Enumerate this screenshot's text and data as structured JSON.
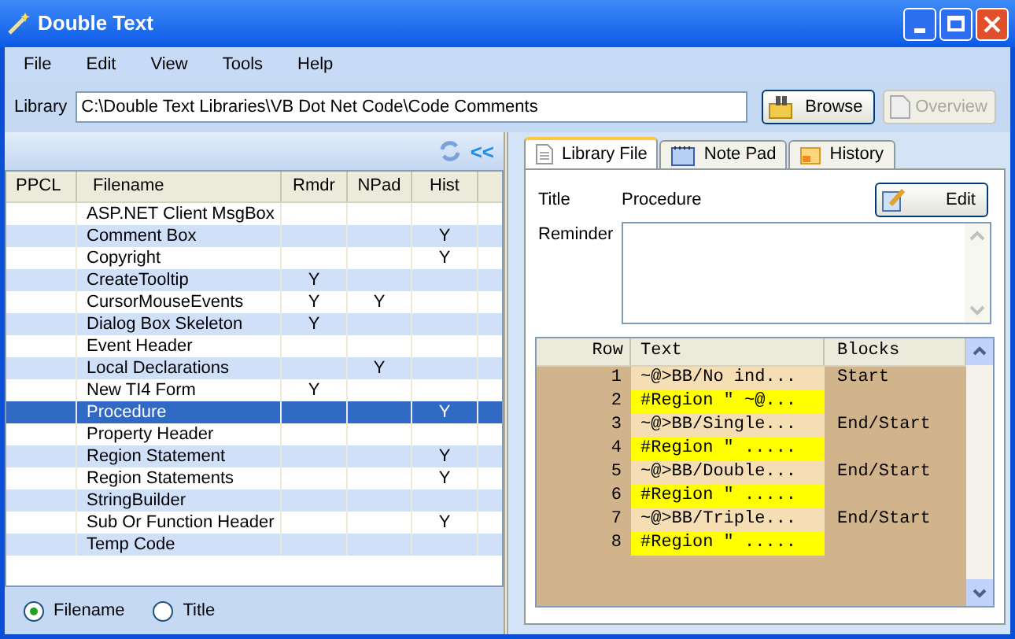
{
  "window": {
    "title": "Double Text"
  },
  "menu": [
    "File",
    "Edit",
    "View",
    "Tools",
    "Help"
  ],
  "library": {
    "label": "Library",
    "value": "C:\\Double Text Libraries\\VB Dot Net Code\\Code Comments",
    "browse": "Browse",
    "overview": {
      "label": "Overview",
      "disabled": true
    }
  },
  "collapse_glyph": "<<",
  "file_table": {
    "columns": [
      "PPCL",
      "Filename",
      "Rmdr",
      "NPad",
      "Hist"
    ],
    "rows": [
      {
        "filename": "ASP.NET Client MsgBox",
        "rmdr": "",
        "npad": "",
        "hist": "",
        "selected": false
      },
      {
        "filename": "Comment Box",
        "rmdr": "",
        "npad": "",
        "hist": "Y",
        "selected": false
      },
      {
        "filename": "Copyright",
        "rmdr": "",
        "npad": "",
        "hist": "Y",
        "selected": false
      },
      {
        "filename": "CreateTooltip",
        "rmdr": "Y",
        "npad": "",
        "hist": "",
        "selected": false
      },
      {
        "filename": "CursorMouseEvents",
        "rmdr": "Y",
        "npad": "Y",
        "hist": "",
        "selected": false
      },
      {
        "filename": "Dialog Box Skeleton",
        "rmdr": "Y",
        "npad": "",
        "hist": "",
        "selected": false
      },
      {
        "filename": "Event Header",
        "rmdr": "",
        "npad": "",
        "hist": "",
        "selected": false
      },
      {
        "filename": "Local Declarations",
        "rmdr": "",
        "npad": "Y",
        "hist": "",
        "selected": false
      },
      {
        "filename": "New TI4 Form",
        "rmdr": "Y",
        "npad": "",
        "hist": "",
        "selected": false
      },
      {
        "filename": "Procedure",
        "rmdr": "",
        "npad": "",
        "hist": "Y",
        "selected": true
      },
      {
        "filename": "Property Header",
        "rmdr": "",
        "npad": "",
        "hist": "",
        "selected": false
      },
      {
        "filename": "Region Statement",
        "rmdr": "",
        "npad": "",
        "hist": "Y",
        "selected": false
      },
      {
        "filename": "Region Statements",
        "rmdr": "",
        "npad": "",
        "hist": "Y",
        "selected": false
      },
      {
        "filename": "StringBuilder",
        "rmdr": "",
        "npad": "",
        "hist": "",
        "selected": false
      },
      {
        "filename": "Sub Or Function Header",
        "rmdr": "",
        "npad": "",
        "hist": "Y",
        "selected": false
      },
      {
        "filename": "Temp Code",
        "rmdr": "",
        "npad": "",
        "hist": "",
        "selected": false
      }
    ]
  },
  "sort_by": [
    {
      "label": "Filename",
      "selected": true
    },
    {
      "label": "Title",
      "selected": false
    }
  ],
  "tabs": [
    {
      "label": "Library File",
      "selected": true
    },
    {
      "label": "Note Pad",
      "selected": false
    },
    {
      "label": "History",
      "selected": false
    }
  ],
  "detail": {
    "title_label": "Title",
    "title_value": "Procedure",
    "edit": "Edit",
    "reminder_label": "Reminder"
  },
  "blocks_table": {
    "columns": [
      "Row",
      "Text",
      "Blocks"
    ],
    "rows": [
      {
        "row": "1",
        "text": "~@>BB/No ind...",
        "blocks": "Start",
        "color": "#f5deb3"
      },
      {
        "row": "2",
        "text": "#Region \" ~@...",
        "blocks": "",
        "color": "#ffff00"
      },
      {
        "row": "3",
        "text": "~@>BB/Single...",
        "blocks": "End/Start",
        "color": "#f5deb3"
      },
      {
        "row": "4",
        "text": "#Region \" .....",
        "blocks": "",
        "color": "#ffff00"
      },
      {
        "row": "5",
        "text": "~@>BB/Double...",
        "blocks": "End/Start",
        "color": "#f5deb3"
      },
      {
        "row": "6",
        "text": "#Region \" .....",
        "blocks": "",
        "color": "#ffff00"
      },
      {
        "row": "7",
        "text": "~@>BB/Triple...",
        "blocks": "End/Start",
        "color": "#f5deb3"
      },
      {
        "row": "8",
        "text": "#Region \" .....",
        "blocks": "",
        "color": "#ffff00"
      }
    ]
  }
}
